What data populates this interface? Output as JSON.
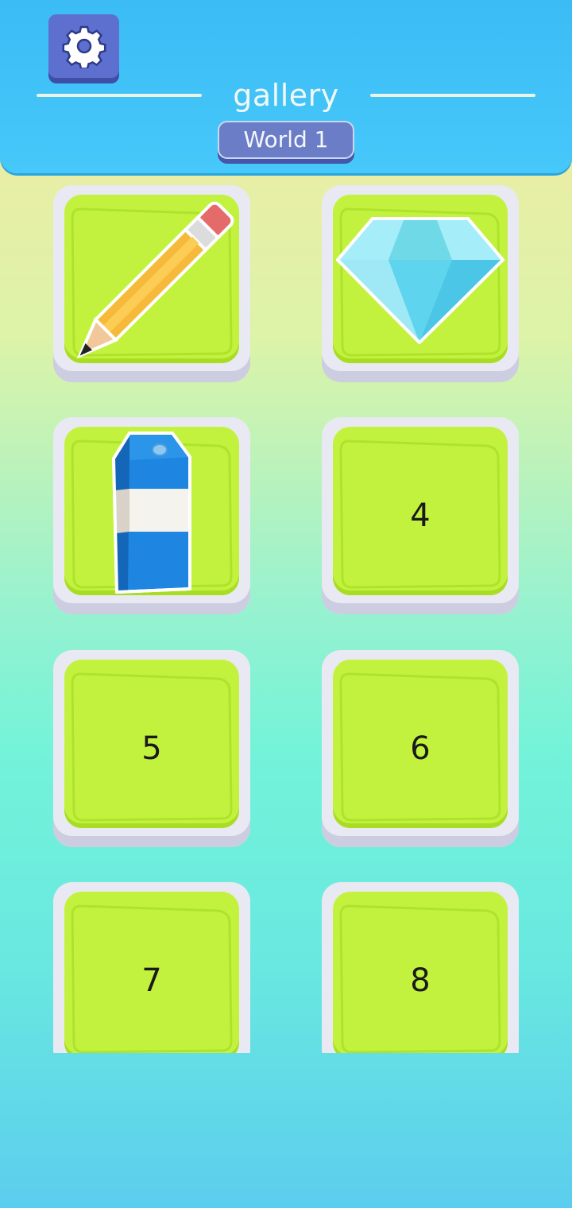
{
  "header": {
    "title": "gallery",
    "world_label": "World 1",
    "settings_icon": "gear-icon",
    "background_color": "#46c8fb",
    "button_color": "#5d70cf"
  },
  "levels": [
    {
      "label": "",
      "image": "pencil"
    },
    {
      "label": "",
      "image": "diamond"
    },
    {
      "label": "",
      "image": "milk-carton"
    },
    {
      "label": "4",
      "image": null
    },
    {
      "label": "5",
      "image": null
    },
    {
      "label": "6",
      "image": null
    },
    {
      "label": "7",
      "image": null
    },
    {
      "label": "8",
      "image": null
    }
  ],
  "colors": {
    "card_face": "#e9e9f3",
    "tile_green": "#c3f23e"
  }
}
